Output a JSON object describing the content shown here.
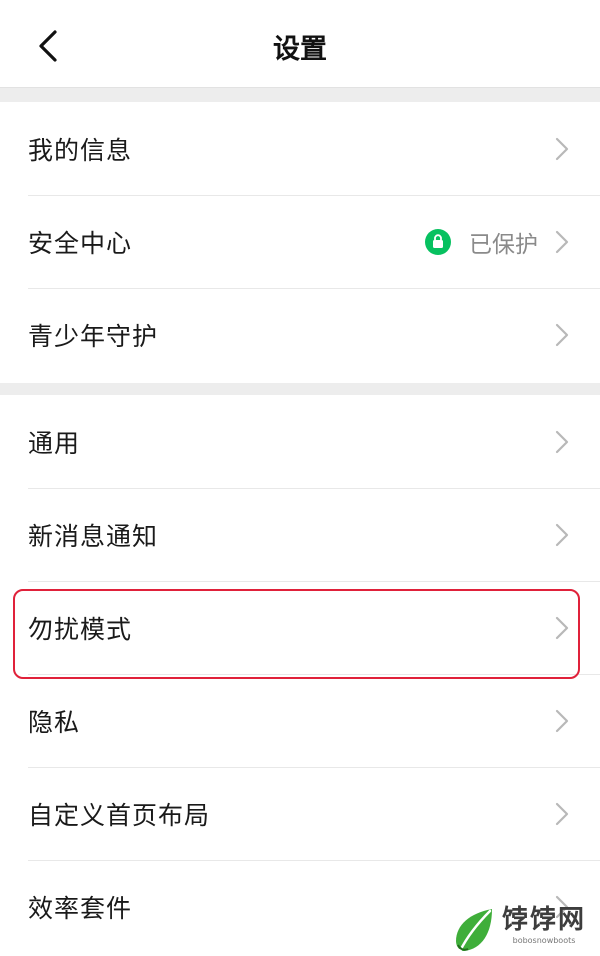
{
  "header": {
    "title": "设置"
  },
  "groups": {
    "account": [
      {
        "label": "我的信息"
      },
      {
        "label": "安全中心",
        "status": "已保护"
      },
      {
        "label": "青少年守护"
      }
    ],
    "settings": [
      {
        "label": "通用"
      },
      {
        "label": "新消息通知"
      },
      {
        "label": "勿扰模式"
      },
      {
        "label": "隐私"
      },
      {
        "label": "自定义首页布局"
      },
      {
        "label": "效率套件"
      }
    ]
  },
  "watermark": {
    "name": "饽饽网",
    "sub": "bobosnowboots"
  },
  "colors": {
    "accent_green": "#07c160",
    "highlight_red": "#e0213a"
  }
}
